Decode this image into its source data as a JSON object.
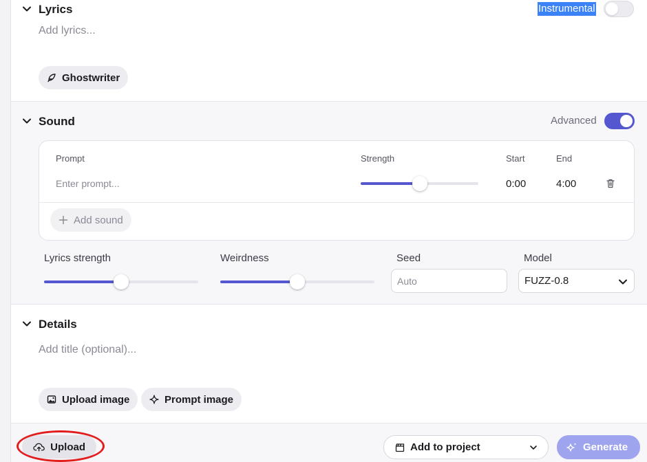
{
  "lyrics": {
    "title": "Lyrics",
    "placeholder": "Add lyrics...",
    "instrumental_label": "Instrumental",
    "instrumental_on": false,
    "ghostwriter_label": "Ghostwriter"
  },
  "sound": {
    "title": "Sound",
    "advanced_label": "Advanced",
    "advanced_on": true,
    "columns": {
      "prompt": "Prompt",
      "strength": "Strength",
      "start": "Start",
      "end": "End"
    },
    "row": {
      "prompt_placeholder": "Enter prompt...",
      "strength": 0.5,
      "start": "0:00",
      "end": "4:00"
    },
    "add_sound_label": "Add sound",
    "lyrics_strength_label": "Lyrics strength",
    "lyrics_strength": 0.5,
    "weirdness_label": "Weirdness",
    "weirdness": 0.5,
    "seed_label": "Seed",
    "seed_placeholder": "Auto",
    "model_label": "Model",
    "model_value": "FUZZ-0.8"
  },
  "details": {
    "title": "Details",
    "title_placeholder": "Add title (optional)...",
    "upload_image_label": "Upload image",
    "prompt_image_label": "Prompt image"
  },
  "footer": {
    "upload_label": "Upload",
    "add_to_project_label": "Add to project",
    "generate_label": "Generate"
  },
  "colors": {
    "accent": "#5457cf",
    "generate_bg": "#9ea4ee",
    "highlight": "#3b82f6",
    "annotation_ring": "#e11d1d"
  },
  "icons": {
    "collapse": "chevron-down-icon",
    "ghostwriter": "feather-icon",
    "delete": "trash-icon",
    "add": "plus-icon",
    "upload_image": "image-icon",
    "prompt_image": "sparkle-icon",
    "upload": "cloud-upload-icon",
    "project": "clapperboard-icon",
    "generate": "sparkles-icon"
  }
}
